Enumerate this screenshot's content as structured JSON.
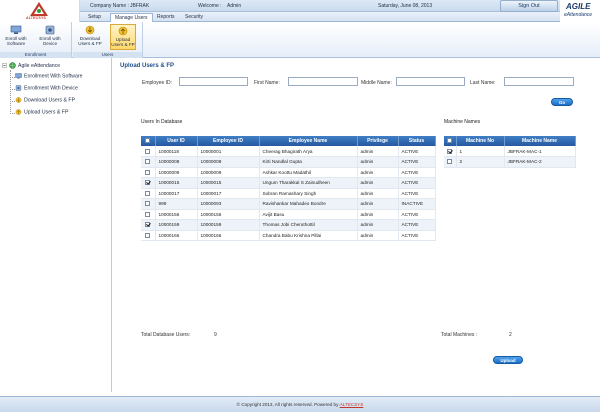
{
  "header": {
    "logo_text": "ALTECSYS",
    "company_label": "Company Name :",
    "company_value": "JBFRAK",
    "welcome_label": "Welcome :",
    "welcome_value": "Admin",
    "date_text": "Saturday, June 08, 2013",
    "signout_label": "Sign Out",
    "brand_line1": "AGILE",
    "brand_line2": "eAttendance"
  },
  "menu": {
    "tabs": [
      "Setup",
      "Manage Users",
      "Reports",
      "Security"
    ]
  },
  "ribbon": {
    "groups": [
      {
        "label": "Enrollment",
        "buttons": [
          "Enroll with Software",
          "Enroll with Device"
        ]
      },
      {
        "label": "Users",
        "buttons": [
          "Download Users & FP",
          "Upload Users & FP"
        ]
      }
    ]
  },
  "tree": {
    "root": "Agile eAttendance",
    "items": [
      "Enrollment With Software",
      "Enrollment With Device",
      "Download Users & FP",
      "Upload Users & FP"
    ]
  },
  "main": {
    "title": "Upload Users & FP",
    "filters": {
      "employee_id_label": "Employee ID:",
      "first_name_label": "First Name:",
      "middle_name_label": "Middle Name:",
      "last_name_label": "Last Name:",
      "employee_id_value": "",
      "first_name_value": "",
      "middle_name_value": "",
      "last_name_value": ""
    },
    "go_label": "Go",
    "users_section_label": "Users In Database",
    "machines_section_label": "Machine Names",
    "users_columns": [
      "User ID",
      "Employee ID",
      "Employee Name",
      "Privilege",
      "Status"
    ],
    "users_rows": [
      {
        "checked": false,
        "user_id": "10000118",
        "employee_id": "10000001",
        "name": "Cheerag Bhagirath Arya",
        "privilege": "admin",
        "status": "ACTIVE"
      },
      {
        "checked": false,
        "user_id": "10000008",
        "employee_id": "10000008",
        "name": "Kirti Nandlal Gupta",
        "privilege": "admin",
        "status": "ACTIVE"
      },
      {
        "checked": false,
        "user_id": "10000009",
        "employee_id": "10000009",
        "name": "Ashkar Koottu Madathil",
        "privilege": "admin",
        "status": "ACTIVE"
      },
      {
        "checked": true,
        "user_id": "10000015",
        "employee_id": "10000015",
        "name": "Ungum Tharakkal S Zainudheen",
        "privilege": "admin",
        "status": "ACTIVE"
      },
      {
        "checked": false,
        "user_id": "10000017",
        "employee_id": "10000017",
        "name": "Sobran Ramashary Singh",
        "privilege": "admin",
        "status": "ACTIVE"
      },
      {
        "checked": false,
        "user_id": "999",
        "employee_id": "10000093",
        "name": "Ravishankar Mahadeo Bondre",
        "privilege": "admin",
        "status": "INACTIVE"
      },
      {
        "checked": false,
        "user_id": "10000156",
        "employee_id": "10000156",
        "name": "Avijit Basu",
        "privilege": "admin",
        "status": "ACTIVE"
      },
      {
        "checked": true,
        "user_id": "10000159",
        "employee_id": "10000159",
        "name": "Thomas Jobi Cheruthottil",
        "privilege": "admin",
        "status": "ACTIVE"
      },
      {
        "checked": false,
        "user_id": "10000166",
        "employee_id": "10000166",
        "name": "Chandra Babu Krishna Pillai",
        "privilege": "admin",
        "status": "ACTIVE"
      }
    ],
    "machine_columns": [
      "Machine No",
      "Machine Name"
    ],
    "machine_rows": [
      {
        "checked": true,
        "no": "1",
        "name": "JBFRAK-MAC-1"
      },
      {
        "checked": false,
        "no": "2",
        "name": "JBFRAK-MAC-2"
      }
    ],
    "total_users_label": "Total Database Users:",
    "total_users_value": "9",
    "total_machines_label": "Total Machines :",
    "total_machines_value": "2",
    "upload_label": "Upload"
  },
  "footer": {
    "text": "© Copyright 2013, All rights reserved. Powered by",
    "brand": "ALTECSYS"
  },
  "colors": {
    "header_blue": "#2559a0",
    "title_blue": "#1d4f8c",
    "button_blue": "#1c6fc6",
    "brand_red": "#c0392b"
  }
}
